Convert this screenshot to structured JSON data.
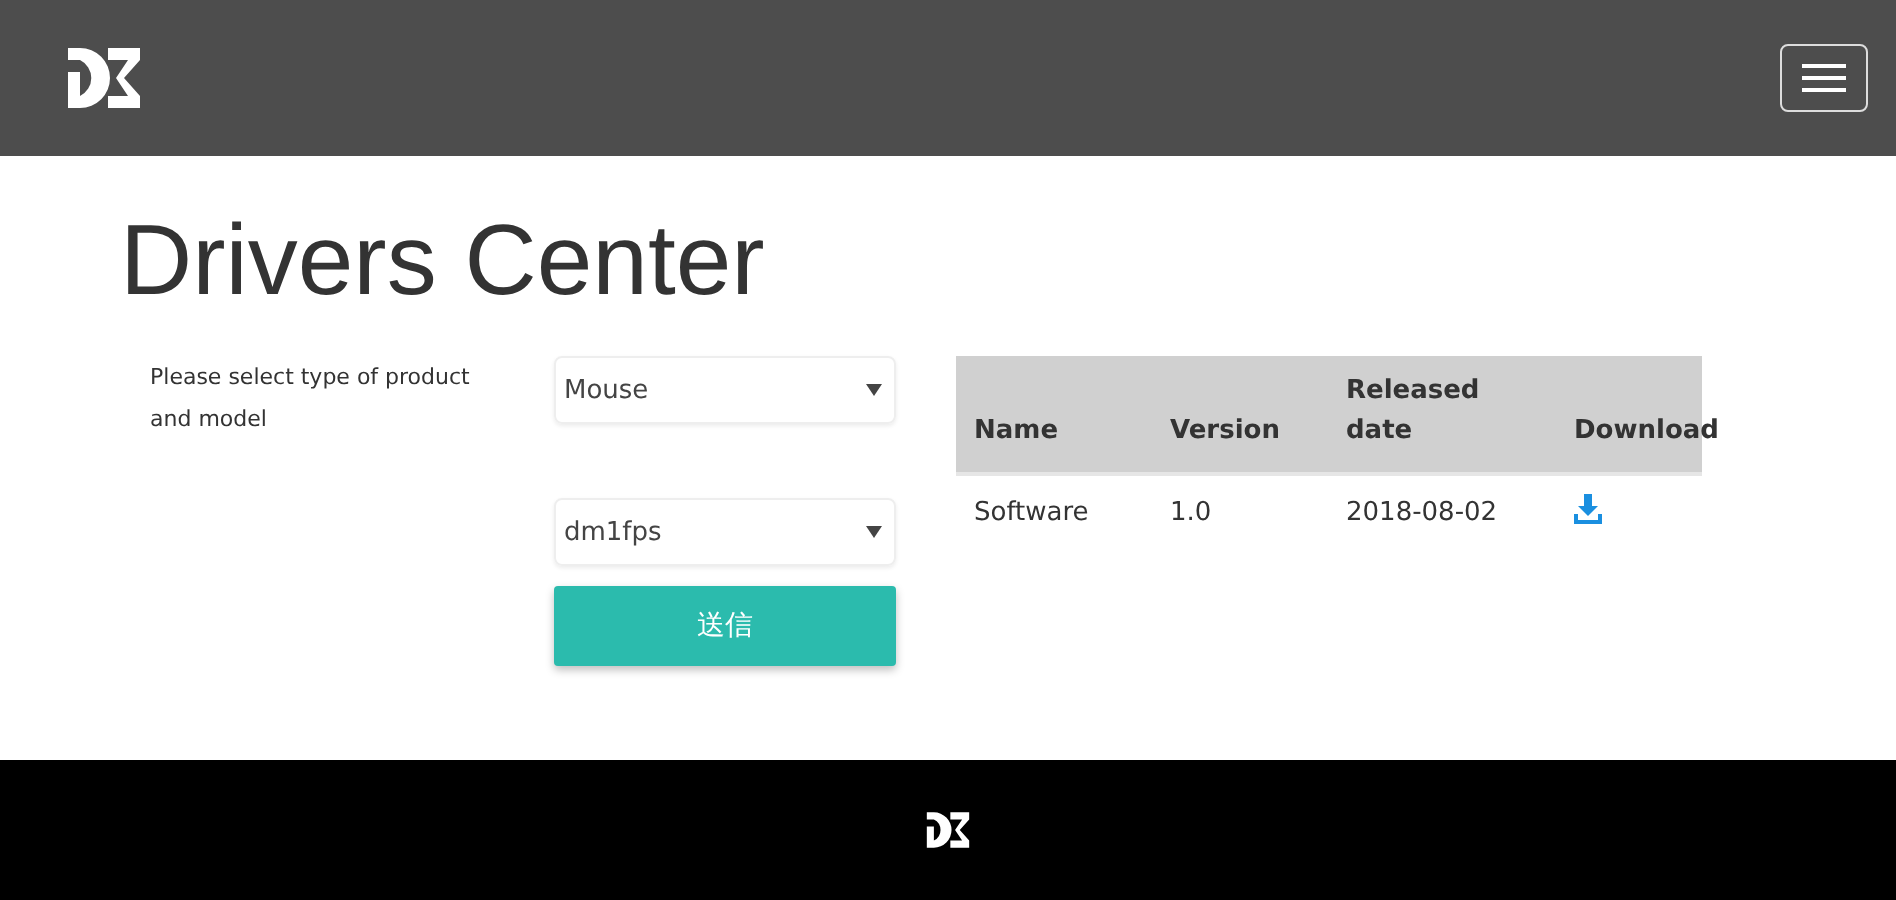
{
  "title": "Drivers Center",
  "form": {
    "label": "Please select type of product and model",
    "selects": [
      {
        "value": "Mouse"
      },
      {
        "value": "dm1fps"
      }
    ],
    "submit": "送信"
  },
  "table": {
    "columns": [
      "Name",
      "Version",
      "Released date",
      "Download"
    ],
    "rows": [
      {
        "name": "Software",
        "version": "1.0",
        "date": "2018-08-02"
      }
    ]
  }
}
